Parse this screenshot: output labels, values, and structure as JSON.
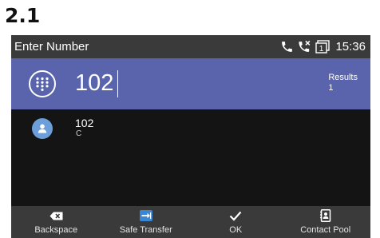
{
  "section_label": "2.1",
  "status_bar": {
    "title": "Enter Number",
    "icons": [
      "phone-icon",
      "missed-call-icon",
      "line-key-icon"
    ],
    "line_key_number": "1",
    "time": "15:36"
  },
  "input": {
    "icon": "dialpad-icon",
    "value": "102",
    "results_label": "Results",
    "results_count": "1"
  },
  "results": [
    {
      "icon": "contact-avatar-icon",
      "number": "102",
      "name": "C"
    }
  ],
  "softkeys": [
    {
      "label": "Backspace",
      "icon": "backspace-icon"
    },
    {
      "label": "Safe Transfer",
      "icon": "transfer-icon"
    },
    {
      "label": "OK",
      "icon": "checkmark-icon"
    },
    {
      "label": "Contact Pool",
      "icon": "contact-book-icon"
    }
  ],
  "colors": {
    "status_bar": "#3a3a3a",
    "input_bar": "#5a64ad",
    "screen_bg": "#141414",
    "avatar": "#6c9fd9",
    "transfer_icon": "#3b86d4"
  }
}
